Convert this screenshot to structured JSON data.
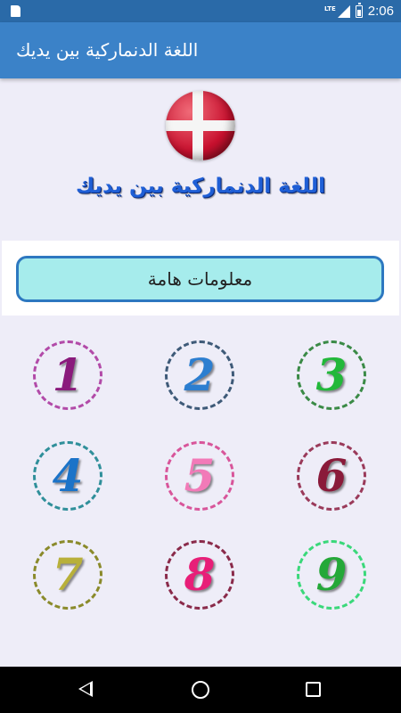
{
  "status_bar": {
    "network": "LTE",
    "time": "2:06",
    "icons": [
      "sd-card-icon",
      "signal-icon",
      "battery-icon"
    ]
  },
  "app_bar": {
    "title": "اللغة الدنماركية بين يديك"
  },
  "header": {
    "flag_icon": "denmark-flag-icon",
    "title": "اللغة الدنماركية بين يديك"
  },
  "info_button": {
    "label": "معلومات هامة"
  },
  "grid": {
    "items": [
      {
        "label": "1",
        "color": "#8a1a7c"
      },
      {
        "label": "2",
        "color": "#2c7ed0"
      },
      {
        "label": "3",
        "color": "#22b83a"
      },
      {
        "label": "4",
        "color": "#1b73c8"
      },
      {
        "label": "5",
        "color": "#f27ab8"
      },
      {
        "label": "6",
        "color": "#8a1a3a"
      },
      {
        "label": "7",
        "color": "#b8b03a"
      },
      {
        "label": "8",
        "color": "#e81e78"
      },
      {
        "label": "9",
        "color": "#24a838"
      }
    ]
  },
  "nav_bar": {
    "icons": [
      "back-icon",
      "home-icon",
      "recents-icon"
    ]
  },
  "colors": {
    "status_bar": "#2a6aa8",
    "app_bar": "#3b82c8",
    "background": "#eeedf8",
    "info_button_fill": "#a6ecec",
    "info_button_border": "#2d78c0"
  }
}
